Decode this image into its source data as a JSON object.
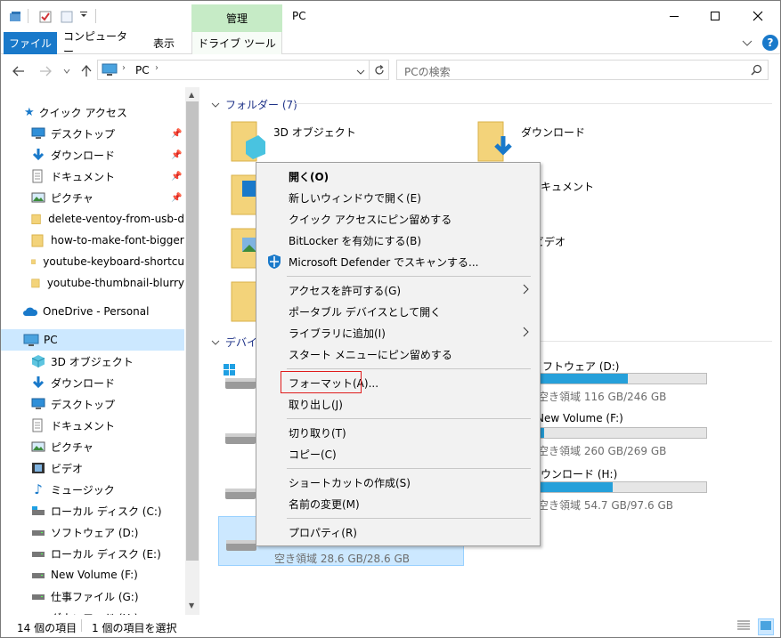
{
  "window": {
    "title": "PC",
    "manage_tab": "管理"
  },
  "ribbon": {
    "tabs": [
      "ファイル",
      "コンピューター",
      "表示",
      "ドライブ ツール"
    ]
  },
  "address": {
    "crumb_root": "PC",
    "search_placeholder": "PCの検索"
  },
  "sidebar": {
    "quick_access": "クイック アクセス",
    "quick_items": [
      "デスクトップ",
      "ダウンロード",
      "ドキュメント",
      "ピクチャ",
      "delete-ventoy-from-usb-d",
      "how-to-make-font-bigger",
      "youtube-keyboard-shortcu",
      "youtube-thumbnail-blurry"
    ],
    "onedrive": "OneDrive - Personal",
    "pc": "PC",
    "pc_items": [
      "3D オブジェクト",
      "ダウンロード",
      "デスクトップ",
      "ドキュメント",
      "ピクチャ",
      "ビデオ",
      "ミュージック",
      "ローカル ディスク (C:)",
      "ソフトウェア (D:)",
      "ローカル ディスク (E:)",
      "New Volume (F:)",
      "仕事ファイル (G:)",
      "ダウンロード (H:)"
    ]
  },
  "content": {
    "folders_header": "フォルダー (7)",
    "folders": [
      "3D オブジェクト",
      "ダウンロード",
      "ドキュメント",
      "ビデオ"
    ],
    "devices_header": "デバイ",
    "drives": [
      {
        "name": "ソフトウェア (D:)",
        "free": "空き領域 116 GB/246 GB",
        "used_fraction": 0.53
      },
      {
        "name": "New Volume (F:)",
        "free": "空き領域 260 GB/269 GB",
        "used_fraction": 0.03
      },
      {
        "name": "ダウンロード (H:)",
        "free": "空き領域 54.7 GB/97.6 GB",
        "used_fraction": 0.44
      }
    ],
    "selected_drive_free": "空き領域 28.6 GB/28.6 GB"
  },
  "context_menu": {
    "items": [
      "開く(O)",
      "新しいウィンドウで開く(E)",
      "クイック アクセスにピン留めする",
      "BitLocker を有効にする(B)",
      "Microsoft Defender でスキャンする...",
      "アクセスを許可する(G)",
      "ポータブル デバイスとして開く",
      "ライブラリに追加(I)",
      "スタート メニューにピン留めする",
      "フォーマット(A)...",
      "取り出し(J)",
      "切り取り(T)",
      "コピー(C)",
      "ショートカットの作成(S)",
      "名前の変更(M)",
      "プロパティ(R)"
    ]
  },
  "status": {
    "count": "14 個の項目",
    "selected": "1 個の項目を選択"
  },
  "colors": {
    "accent": "#1979ca",
    "manage_tab": "#c6ebc6",
    "selection": "#cce8ff",
    "format_highlight": "#e01b1b"
  }
}
